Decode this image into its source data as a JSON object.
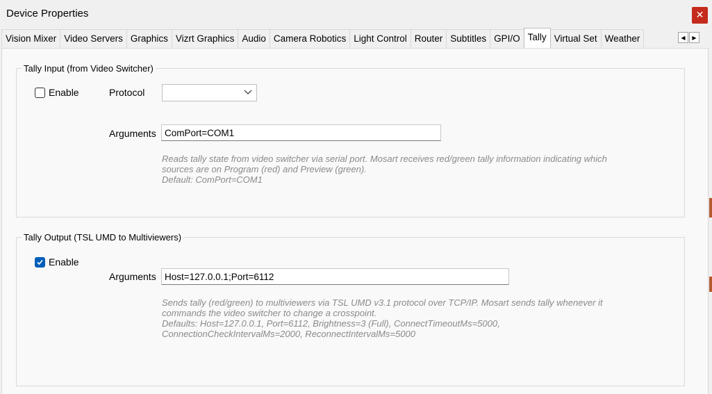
{
  "window": {
    "title": "Device Properties",
    "close_icon": "✕"
  },
  "tabs": [
    {
      "label": "Vision Mixer",
      "active": false
    },
    {
      "label": "Video Servers",
      "active": false
    },
    {
      "label": "Graphics",
      "active": false
    },
    {
      "label": "Vizrt Graphics",
      "active": false
    },
    {
      "label": "Audio",
      "active": false
    },
    {
      "label": "Camera Robotics",
      "active": false
    },
    {
      "label": "Light Control",
      "active": false
    },
    {
      "label": "Router",
      "active": false
    },
    {
      "label": "Subtitles",
      "active": false
    },
    {
      "label": "GPI/O",
      "active": false
    },
    {
      "label": "Tally",
      "active": true
    },
    {
      "label": "Virtual Set",
      "active": false
    },
    {
      "label": "Weather",
      "active": false
    }
  ],
  "tab_scroll": {
    "left": "◀",
    "right": "▶"
  },
  "tally_input": {
    "legend": "Tally Input (from Video Switcher)",
    "enable_label": "Enable",
    "enable_checked": false,
    "protocol_label": "Protocol",
    "protocol_value": "",
    "arguments_label": "Arguments",
    "arguments_value": "ComPort=COM1",
    "help_lines": [
      "Reads tally state from video switcher via serial port. Mosart receives red/green tally information indicating which",
      "sources are on Program (red) and Preview (green).",
      "Default: ComPort=COM1"
    ]
  },
  "tally_output": {
    "legend": "Tally Output (TSL UMD to Multiviewers)",
    "enable_label": "Enable",
    "enable_checked": true,
    "arguments_label": "Arguments",
    "arguments_value": "Host=127.0.0.1;Port=6112",
    "help_lines": [
      "Sends tally (red/green) to multiviewers via TSL UMD v3.1 protocol over TCP/IP. Mosart sends tally whenever it",
      "commands the video switcher to change a crosspoint.",
      "Defaults: Host=127.0.0.1, Port=6112, Brightness=3 (Full), ConnectTimeoutMs=5000,",
      "ConnectionCheckIntervalMs=2000, ReconnectIntervalMs=5000"
    ]
  },
  "colors": {
    "accent": "#005fb8",
    "close": "#c42b1c",
    "help_text": "#8a8a8a"
  }
}
